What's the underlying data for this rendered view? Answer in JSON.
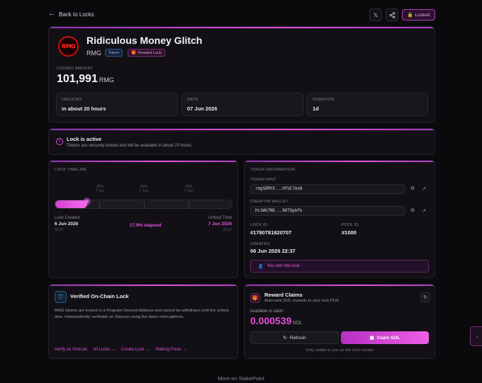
{
  "nav": {
    "back_label": "Back to Locks",
    "locked_badge": "Locked"
  },
  "token": {
    "logo_text": "RMG",
    "name": "Ridiculous Money Glitch",
    "symbol": "RMG",
    "type_pill": "Token",
    "reward_pill": "Reward Lock"
  },
  "locked": {
    "label": "LOCKED AMOUNT",
    "amount": "101,991",
    "unit": "RMG"
  },
  "stats": [
    {
      "label": "UNLOCKS",
      "value": "in about 20 hours"
    },
    {
      "label": "DATE",
      "value": "07 Jun 2026"
    },
    {
      "label": "DURATION",
      "value": "1d"
    }
  ],
  "status": {
    "title": "Lock is active",
    "subtitle": "Tokens are securely locked and will be available in about 20 hours."
  },
  "timeline": {
    "label": "LOCK TIMELINE",
    "progress_fraction": 0.179,
    "ticks": [
      {
        "pct": "25%",
        "date": "7 Jun"
      },
      {
        "pct": "50%",
        "date": "7 Jun"
      },
      {
        "pct": "75%",
        "date": "7 Jun"
      }
    ],
    "created_label": "Lock Created",
    "created_date": "6 Jun 2026",
    "created_time": "22:37",
    "elapsed": "17.9% elapsed",
    "unlock_label": "Unlock Time",
    "unlock_date": "7 Jun 2026",
    "unlock_time": "22:37"
  },
  "info": {
    "label": "TOKEN INFORMATION",
    "mint_label": "TOKEN MINT",
    "mint": "rmgSDMYX...HfUC7AxN",
    "creator_label": "CREATOR WALLET",
    "creator": "Hc1Wk7ND...86TQpbFb",
    "lock_id_label": "LOCK ID",
    "lock_id": "#1780781820707",
    "pool_id_label": "POOL ID",
    "pool_id": "#1000",
    "created_label": "CREATED",
    "created": "06 Jun 2026 22:37",
    "own_note": "You own this lock"
  },
  "verified": {
    "title": "Verified On-Chain Lock",
    "body": "RMG tokens are locked in a Program Derived Address and cannot be withdrawn until the unlock time. Independently verifiable on Solscan using the token mint address.",
    "links": [
      "Verify on Solscan",
      "All Locks →",
      "Create Lock →",
      "Staking Pools →"
    ]
  },
  "rewards": {
    "title": "Reward Claims",
    "subtitle": "Auto-sent SOL rewards to your lock PDA",
    "available_label": "Available to claim",
    "amount": "0.000539",
    "unit": "SOL",
    "refresh_label": "Refresh",
    "claim_label": "Claim SOL",
    "note": "Only visible to you as the lock creator"
  },
  "footer": {
    "more": "More on StakePoint"
  },
  "colors": {
    "accent": "#e94fe3",
    "background": "#0a090c",
    "card": "#121015"
  }
}
